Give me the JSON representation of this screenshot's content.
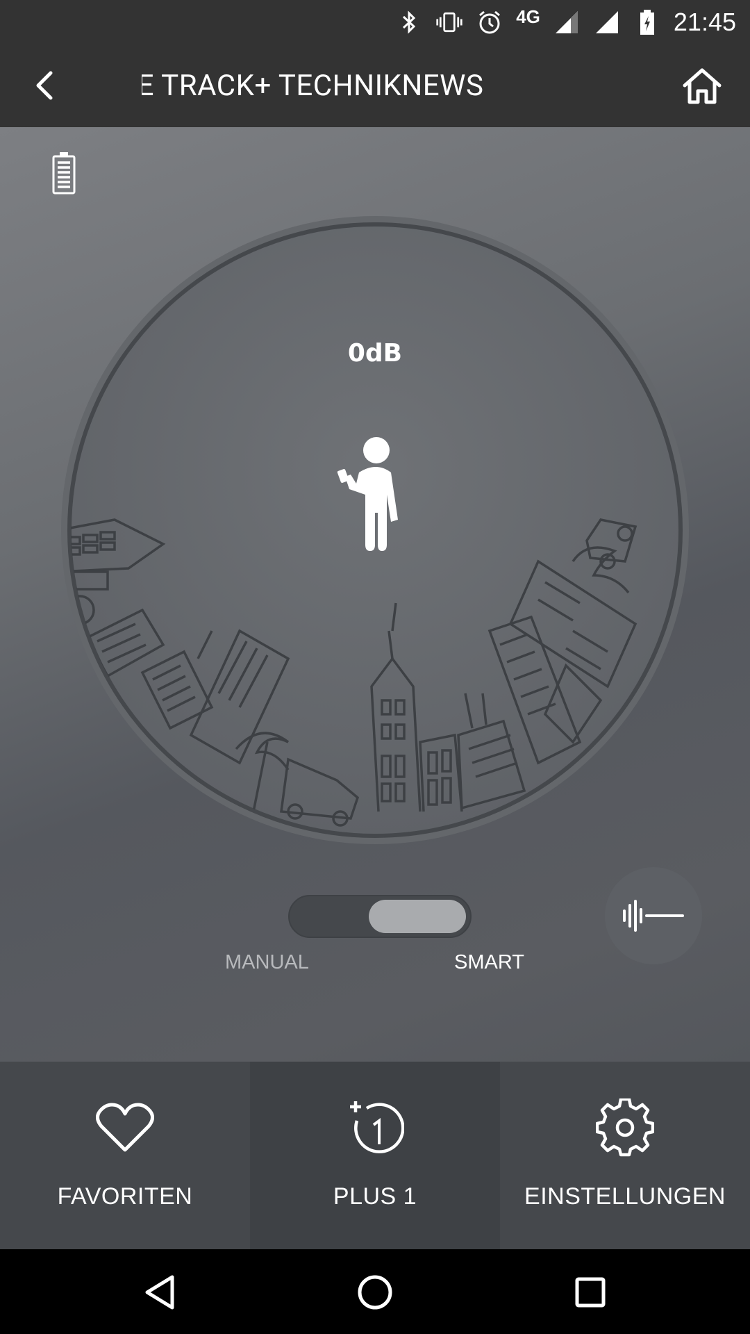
{
  "status_bar": {
    "network": "4G",
    "time": "21:45",
    "icons": [
      "bluetooth-icon",
      "vibrate-icon",
      "alarm-icon",
      "signal-icon",
      "signal-icon",
      "battery-charging-icon"
    ]
  },
  "app_bar": {
    "title": "JE TRACK+ TECHNIKNEWS",
    "back_icon": "chevron-left-icon",
    "home_icon": "home-icon"
  },
  "main": {
    "battery_icon": "battery-icon",
    "db_value": "0dB",
    "listener_icon": "person-icon",
    "mode": {
      "manual_label": "MANUAL",
      "smart_label": "SMART",
      "selected": "SMART"
    },
    "eq_icon": "sound-wave-icon"
  },
  "bottom_nav": {
    "items": [
      {
        "label": "FAVORITEN",
        "icon": "heart-icon"
      },
      {
        "label": "PLUS 1",
        "icon": "plus-one-icon"
      },
      {
        "label": "EINSTELLUNGEN",
        "icon": "gear-icon"
      }
    ]
  },
  "system_nav": {
    "icons": [
      "back-triangle-icon",
      "home-circle-icon",
      "recents-square-icon"
    ]
  },
  "colors": {
    "bar": "#333333",
    "nav": "#45484c",
    "nav_active": "#3e4145"
  }
}
